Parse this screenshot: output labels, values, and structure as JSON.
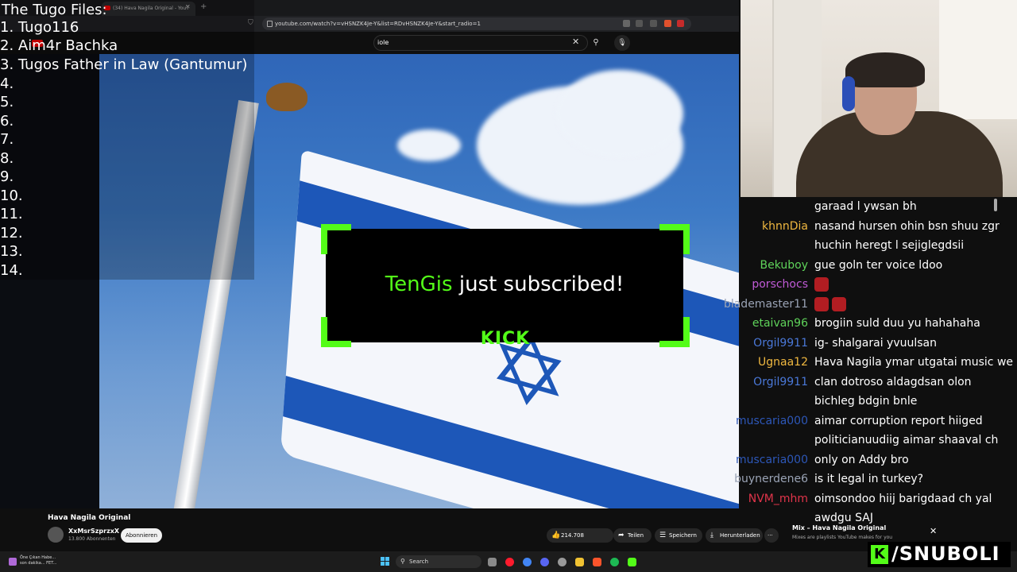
{
  "browser": {
    "tab_title": "(34) Hava Nagila Original - YouT",
    "url": "youtube.com/watch?v=vHSNZK4Je-Y&list=RDvHSNZK4Je-Y&start_radio=1"
  },
  "youtube": {
    "search_value": "iole",
    "video_title": "Hava Nagila Original",
    "channel_name": "XxMsrSzprzxX",
    "subscriber_count": "13.800 Abonnenten",
    "subscribe_label": "Abonnieren",
    "like_count": "214.708",
    "share_label": "Teilen",
    "save_label": "Speichern",
    "download_label": "Herunterladen",
    "more_label": "···",
    "mix_title": "Mix – Hava Nagila Original",
    "mix_subtitle": "Mixes are playlists YouTube makes for you"
  },
  "tugo_files": {
    "title": "The Tugo Files:",
    "items": [
      "1. Tugo116",
      "2. Aim4r Bachka",
      "3. Tugos Father in Law (Gantumur)",
      "4.",
      "5.",
      "6.",
      "7.",
      "8.",
      "9.",
      "10.",
      "11.",
      "12.",
      "13.",
      "14."
    ]
  },
  "alert": {
    "username": "TenGis",
    "message": "just subscribed!",
    "brand": "KICK"
  },
  "chat": [
    {
      "user": "",
      "color": "#ffffff",
      "message": "garaad l ywsan bh",
      "emotes": 0
    },
    {
      "user": "khnnDia",
      "color": "#f0b840",
      "message": "nasand hursen ohin bsn shuu zgr",
      "emotes": 0
    },
    {
      "user": "",
      "color": "#ffffff",
      "message": "huchin heregt l sejiglegdsii",
      "emotes": 0
    },
    {
      "user": "Bekuboy",
      "color": "#5fd35a",
      "message": "gue goln ter voice ldoo",
      "emotes": 0
    },
    {
      "user": "porschocs",
      "color": "#c05ad6",
      "message": "",
      "emotes": 1
    },
    {
      "user": "blademaster11",
      "color": "#9aa3b5",
      "message": "",
      "emotes": 2
    },
    {
      "user": "etaivan96",
      "color": "#5fd35a",
      "message": "brogiin suld duu yu hahahaha",
      "emotes": 0
    },
    {
      "user": "Orgil9911",
      "color": "#4a78d8",
      "message": "ig- shalgarai yvuulsan",
      "emotes": 0
    },
    {
      "user": "Ugnaa12",
      "color": "#f0b840",
      "message": "Hava Nagila ymar utgatai music we",
      "emotes": 0
    },
    {
      "user": "Orgil9911",
      "color": "#4a78d8",
      "message": "clan dotroso aldagdsan olon",
      "emotes": 0
    },
    {
      "user": "",
      "color": "#ffffff",
      "message": "bichleg bdgin bnle",
      "emotes": 0
    },
    {
      "user": "muscaria000",
      "color": "#2d57b8",
      "message": "aimar corruption report hiiged",
      "emotes": 0
    },
    {
      "user": "",
      "color": "#ffffff",
      "message": "politicianuudiig aimar shaaval ch",
      "emotes": 0
    },
    {
      "user": "muscaria000",
      "color": "#2d57b8",
      "message": "only on Addy bro",
      "emotes": 0
    },
    {
      "user": "buynerdene6",
      "color": "#9aa3b5",
      "message": "is it legal in turkey?",
      "emotes": 0
    },
    {
      "user": "NVM_mhm",
      "color": "#e0344a",
      "message": "oimsondoo hiij barigdaad ch yal",
      "emotes": 0
    },
    {
      "user": "",
      "color": "#ffffff",
      "message": "awdgu SAJ",
      "emotes": 0
    }
  ],
  "taskbar": {
    "news_line1": "Öne Çıkan Habe...",
    "news_line2": "son dakika... FET...",
    "search_label": "Search"
  },
  "kick_handle": "/SNUBOLI",
  "colors": {
    "kick_green": "#53fc18",
    "youtube_red": "#ff0000",
    "flag_blue": "#1d57b8"
  }
}
